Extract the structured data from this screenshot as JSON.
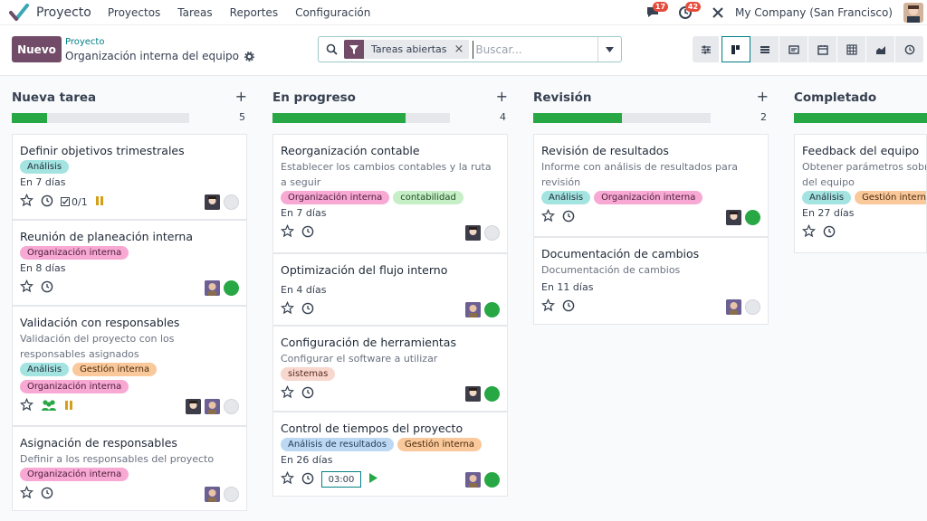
{
  "app": {
    "title": "Proyecto"
  },
  "menu": [
    {
      "label": "Proyectos"
    },
    {
      "label": "Tareas"
    },
    {
      "label": "Reportes"
    },
    {
      "label": "Configuración"
    }
  ],
  "systray": {
    "messages_count": "17",
    "activities_count": "42",
    "company": "My Company (San Francisco)"
  },
  "control": {
    "new_label": "Nuevo",
    "breadcrumb": "Proyecto",
    "page_title": "Organización interna del equipo",
    "facet_label": "Tareas abiertas",
    "search_placeholder": "Buscar..."
  },
  "colors": {
    "primary": "#714b67",
    "accent": "#017e84",
    "progress": "#28a745"
  },
  "columns": [
    {
      "title": "Nueva tarea",
      "count": "5",
      "progress": 0.2,
      "cards": [
        {
          "title": "Definir objetivos trimestrales",
          "desc": "",
          "tags": [
            {
              "label": "Análisis",
              "cls": "t-analisis"
            }
          ],
          "deadline": "En 7 días",
          "subtasks": "0/1",
          "state": "grey",
          "avatars": [
            "a"
          ]
        },
        {
          "title": "Reunión de planeación interna",
          "desc": "",
          "tags": [
            {
              "label": "Organización interna",
              "cls": "t-org"
            }
          ],
          "deadline": "En 8 días",
          "state": "green",
          "avatars": [
            "b"
          ]
        },
        {
          "title": "Validación con responsables",
          "desc": "Validación del proyecto con los responsables asignados",
          "tags": [
            {
              "label": "Análisis",
              "cls": "t-analisis"
            },
            {
              "label": "Gestión interna",
              "cls": "t-gestion"
            },
            {
              "label": "Organización interna",
              "cls": "t-org"
            }
          ],
          "deadline": "",
          "state": "grey",
          "avatars": [
            "a",
            "b"
          ]
        },
        {
          "title": "Asignación de responsables",
          "desc": "Definir a los responsables del proyecto",
          "tags": [
            {
              "label": "Organización interna",
              "cls": "t-org"
            }
          ],
          "deadline": "",
          "state": "grey",
          "avatars": [
            "b"
          ]
        }
      ]
    },
    {
      "title": "En progreso",
      "count": "4",
      "progress": 0.75,
      "cards": [
        {
          "title": "Reorganización contable",
          "desc": "Establecer los cambios contables y la ruta a seguir",
          "tags": [
            {
              "label": "Organización interna",
              "cls": "t-org"
            },
            {
              "label": "contabilidad",
              "cls": "t-cont"
            }
          ],
          "deadline": "En 7 días",
          "state": "grey",
          "avatars": [
            "a"
          ]
        },
        {
          "title": "Optimización del flujo interno",
          "desc": "",
          "tags": [],
          "deadline": "En 4 días",
          "state": "green",
          "avatars": [
            "b"
          ]
        },
        {
          "title": "Configuración de herramientas",
          "desc": "Configurar el software a utilizar",
          "tags": [
            {
              "label": "sistemas",
              "cls": "t-sis"
            }
          ],
          "deadline": "",
          "state": "green",
          "avatars": [
            "a"
          ]
        },
        {
          "title": "Control de tiempos del proyecto",
          "desc": "",
          "tags": [
            {
              "label": "Análisis de resultados",
              "cls": "t-analres"
            },
            {
              "label": "Gestión interna",
              "cls": "t-gestion"
            }
          ],
          "deadline": "En 26 días",
          "timer": "03:00",
          "state": "green",
          "avatars": [
            "b"
          ]
        }
      ]
    },
    {
      "title": "Revisión",
      "count": "2",
      "progress": 0.5,
      "cards": [
        {
          "title": "Revisión de resultados",
          "desc": "Informe con análisis de resultados para revisión",
          "tags": [
            {
              "label": "Análisis",
              "cls": "t-analisis"
            },
            {
              "label": "Organización interna",
              "cls": "t-org"
            }
          ],
          "deadline": "",
          "state": "green",
          "avatars": [
            "a"
          ]
        },
        {
          "title": "Documentación de cambios",
          "desc": "Documentación de cambios",
          "tags": [],
          "deadline": "En 11 días",
          "state": "grey",
          "avatars": [
            "b"
          ]
        }
      ]
    },
    {
      "title": "Completado",
      "count": "",
      "progress": 1.0,
      "cards": [
        {
          "title": "Feedback del equipo",
          "desc": "Obtener parámetros sobre del equipo",
          "tags": [
            {
              "label": "Análisis",
              "cls": "t-analisis"
            },
            {
              "label": "Gestión interna",
              "cls": "t-gestion"
            }
          ],
          "deadline": "En 27 días",
          "state": "none",
          "avatars": []
        }
      ]
    }
  ]
}
